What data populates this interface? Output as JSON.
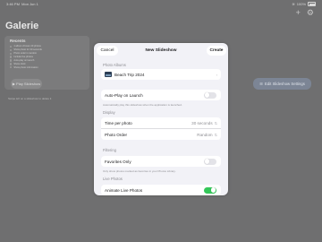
{
  "status": {
    "time": "3:46 PM",
    "date": "Mon Jun 1",
    "battery": "100%"
  },
  "top_icons": {
    "add": "+",
    "settings": "⚙"
  },
  "app": {
    "title": "Galerie"
  },
  "recents": {
    "title": "Recents",
    "items": [
      "1 album chosen 40 photos",
      "Show photo for 30 seconds",
      "Photo order is random",
      "Include live photos",
      "Auto-play on launch",
      "Show clock",
      "Show photo information"
    ]
  },
  "play_button": {
    "label": "Play Slideshow"
  },
  "background_note": "Swipe left on a slideshow to delete it",
  "edit_button": {
    "label": "Edit Slideshow Settings"
  },
  "sheet": {
    "cancel": "Cancel",
    "title": "New Slideshow",
    "create": "Create",
    "photo_albums": {
      "header": "Photo Albums",
      "album": "Beach Trip 2024",
      "chevron": "›"
    },
    "autoplay": {
      "label": "Auto-Play on Launch",
      "on": false,
      "note": "Automatically play this slideshow when the application is launched."
    },
    "display": {
      "header": "Display",
      "time_label": "Time per photo",
      "time_value": "30 seconds",
      "order_label": "Photo Order",
      "order_value": "Random",
      "stepper_icon": "⇅"
    },
    "filtering": {
      "header": "Filtering",
      "favorites_label": "Favorites Only",
      "favorites_on": false,
      "note": "Only show photos marked as favorites in your Photos Library."
    },
    "live_photos": {
      "header": "Live Photos",
      "animate_label": "Animate Live Photos",
      "animate_on": true
    }
  },
  "colors": {
    "toggle_on": "#34c759",
    "backdrop": "#6f6f70",
    "sheet_bg": "#f2f2f7"
  }
}
